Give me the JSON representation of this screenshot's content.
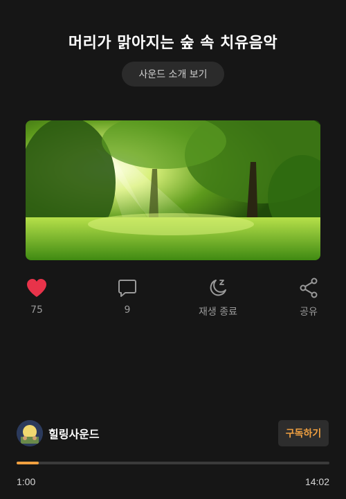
{
  "header": {
    "title": "머리가 맑아지는 숲 속 치유음악",
    "intro_button": "사운드 소개 보기"
  },
  "artwork": {
    "icon": "forest-sunlight-image"
  },
  "actions": [
    {
      "name": "like",
      "icon": "heart-icon",
      "label": "75",
      "color": "#e8334a"
    },
    {
      "name": "comment",
      "icon": "comment-icon",
      "label": "9"
    },
    {
      "name": "sleep-timer",
      "icon": "moon-icon",
      "label": "재생 종료"
    },
    {
      "name": "share",
      "icon": "share-icon",
      "label": "공유"
    }
  ],
  "channel": {
    "name": "힐링사운드",
    "subscribe_label": "구독하기"
  },
  "player": {
    "current_time": "1:00",
    "total_time": "14:02",
    "progress": 0.071,
    "accent_color": "#f0a040"
  }
}
